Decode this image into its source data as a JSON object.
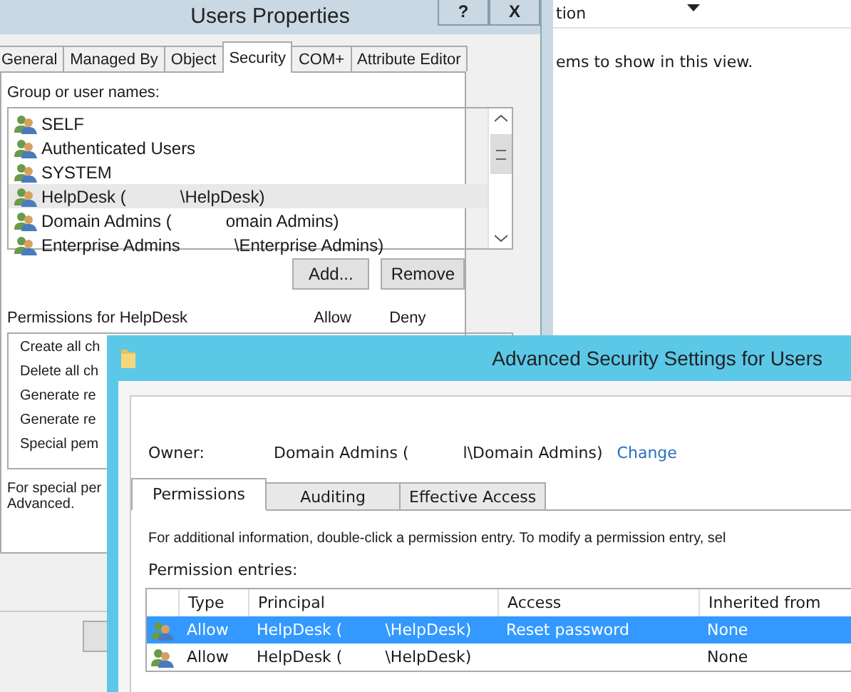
{
  "background_window": {
    "column_header": "tion",
    "empty_message": "ems to show in this view."
  },
  "users_properties": {
    "title": "Users Properties",
    "title_buttons": [
      "?",
      "X"
    ],
    "tabs": [
      {
        "label": "General",
        "selected": false
      },
      {
        "label": "Managed By",
        "selected": false
      },
      {
        "label": "Object",
        "selected": false
      },
      {
        "label": "Security",
        "selected": true
      },
      {
        "label": "COM+",
        "selected": false
      },
      {
        "label": "Attribute Editor",
        "selected": false
      }
    ],
    "group_label": "Group or user names:",
    "principals": [
      {
        "parts": [
          "SELF"
        ],
        "selected": false
      },
      {
        "parts": [
          "Authenticated Users"
        ],
        "selected": false
      },
      {
        "parts": [
          "SYSTEM"
        ],
        "selected": false
      },
      {
        "parts": [
          "HelpDesk (",
          "\\HelpDesk)"
        ],
        "selected": true
      },
      {
        "parts": [
          "Domain Admins (",
          "omain Admins)"
        ],
        "selected": false
      },
      {
        "parts": [
          "Enterprise Admins",
          "\\Enterprise Admins)"
        ],
        "selected": false
      }
    ],
    "buttons": [
      "Add...",
      "Remove"
    ],
    "permissions_label": "Permissions for HelpDesk",
    "columns": [
      "Allow",
      "Deny"
    ],
    "permissions": [
      "Create all ch",
      "Delete all ch",
      "Generate re",
      "Generate re",
      "Special pem"
    ],
    "note": [
      "For special per",
      "Advanced."
    ]
  },
  "advanced_window": {
    "title": "Advanced Security Settings for Users",
    "owner_label": "Owner:",
    "owner_parts": [
      "Domain Admins (",
      "l\\Domain Admins)"
    ],
    "owner_link": "Change",
    "tabs": [
      {
        "label": "Permissions",
        "selected": true
      },
      {
        "label": "Auditing",
        "selected": false
      },
      {
        "label": "Effective Access",
        "selected": false
      }
    ],
    "info": "For additional information, double-click a permission entry. To modify a permission entry, sel",
    "entries_label": "Permission entries:",
    "columns": [
      "Type",
      "Principal",
      "Access",
      "Inherited from"
    ],
    "rows": [
      {
        "type": "Allow",
        "principal": [
          "HelpDesk (",
          "\\HelpDesk)"
        ],
        "access": "Reset password",
        "inherited": "None",
        "selected": true
      },
      {
        "type": "Allow",
        "principal": [
          "HelpDesk (",
          "\\HelpDesk)"
        ],
        "access": "",
        "inherited": "None",
        "selected": false
      }
    ]
  }
}
